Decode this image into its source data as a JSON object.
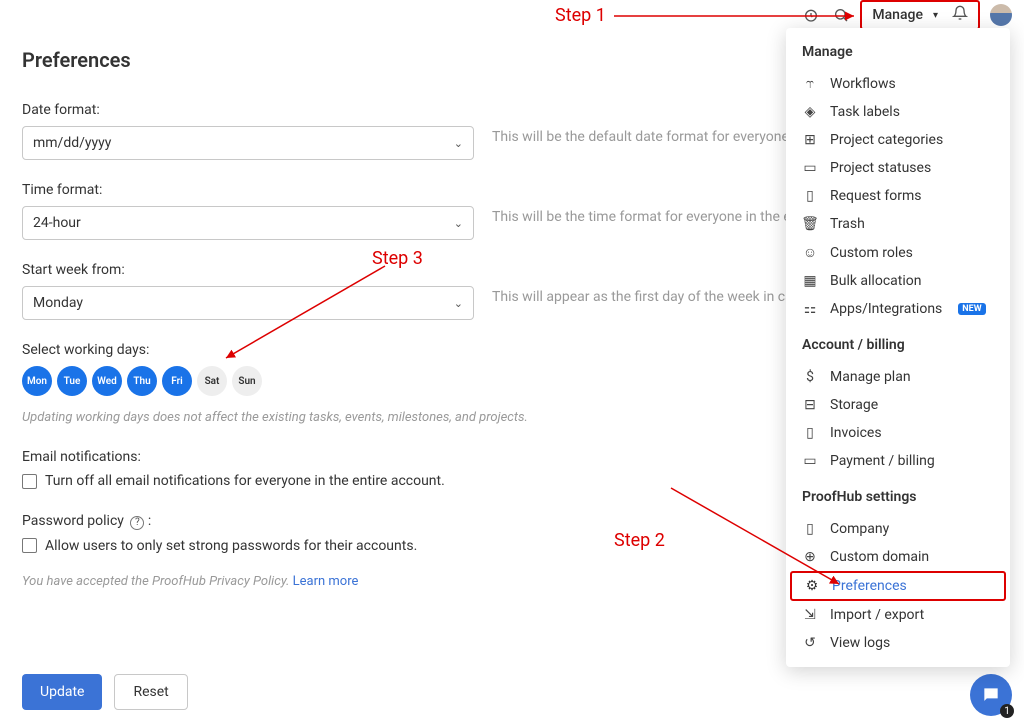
{
  "topbar": {
    "manage_label": "Manage"
  },
  "page": {
    "title": "Preferences",
    "date_format_label": "Date format:",
    "date_format_value": "mm/dd/yyyy",
    "date_format_help": "This will be the default date format for everyone in the e",
    "time_format_label": "Time format:",
    "time_format_value": "24-hour",
    "time_format_help": "This will be the time format for everyone in the entire ac",
    "start_week_label": "Start week from:",
    "start_week_value": "Monday",
    "start_week_help": "This will appear as the first day of the week in calendar the entire account.",
    "working_days_label": "Select working days:",
    "days": [
      {
        "abbr": "Mon",
        "selected": true
      },
      {
        "abbr": "Tue",
        "selected": true
      },
      {
        "abbr": "Wed",
        "selected": true
      },
      {
        "abbr": "Thu",
        "selected": true
      },
      {
        "abbr": "Fri",
        "selected": true
      },
      {
        "abbr": "Sat",
        "selected": false
      },
      {
        "abbr": "Sun",
        "selected": false
      }
    ],
    "working_days_note": "Updating working days does not affect the existing tasks, events, milestones, and projects.",
    "email_label": "Email notifications:",
    "email_checkbox_text": "Turn off all email notifications for everyone in the entire account.",
    "password_label": "Password policy",
    "password_checkbox_text": "Allow users to only set strong passwords for their accounts.",
    "policy_note_text": "You have accepted the ProofHub Privacy Policy. ",
    "policy_link": "Learn more",
    "update_btn": "Update",
    "reset_btn": "Reset"
  },
  "menu": {
    "sections": [
      {
        "header": "Manage",
        "items": [
          {
            "icon": "workflow-icon",
            "glyph": "⥾",
            "label": "Workflows"
          },
          {
            "icon": "tag-icon",
            "glyph": "◈",
            "label": "Task labels"
          },
          {
            "icon": "grid-icon",
            "glyph": "⊞",
            "label": "Project categories"
          },
          {
            "icon": "folder-icon",
            "glyph": "▭",
            "label": "Project statuses"
          },
          {
            "icon": "clipboard-icon",
            "glyph": "▯",
            "label": "Request forms"
          },
          {
            "icon": "trash-icon",
            "glyph": "🗑",
            "label": "Trash"
          },
          {
            "icon": "person-icon",
            "glyph": "☺",
            "label": "Custom roles"
          },
          {
            "icon": "calendar-icon",
            "glyph": "▦",
            "label": "Bulk allocation"
          },
          {
            "icon": "apps-icon",
            "glyph": "⚏",
            "label": "Apps/Integrations",
            "badge": "NEW"
          }
        ]
      },
      {
        "header": "Account / billing",
        "items": [
          {
            "icon": "dollar-icon",
            "glyph": "$",
            "label": "Manage plan"
          },
          {
            "icon": "storage-icon",
            "glyph": "⊟",
            "label": "Storage"
          },
          {
            "icon": "invoice-icon",
            "glyph": "▯",
            "label": "Invoices"
          },
          {
            "icon": "card-icon",
            "glyph": "▭",
            "label": "Payment / billing"
          }
        ]
      },
      {
        "header": "ProofHub settings",
        "items": [
          {
            "icon": "building-icon",
            "glyph": "▯",
            "label": "Company"
          },
          {
            "icon": "globe-icon",
            "glyph": "⊕",
            "label": "Custom domain"
          },
          {
            "icon": "gear-icon",
            "glyph": "⚙",
            "label": "Preferences",
            "highlight": true
          },
          {
            "icon": "import-icon",
            "glyph": "⇲",
            "label": "Import / export"
          },
          {
            "icon": "history-icon",
            "glyph": "↺",
            "label": "View logs"
          }
        ]
      }
    ]
  },
  "callouts": {
    "step1": "Step 1",
    "step2": "Step 2",
    "step3": "Step 3"
  },
  "fab_count": "1"
}
